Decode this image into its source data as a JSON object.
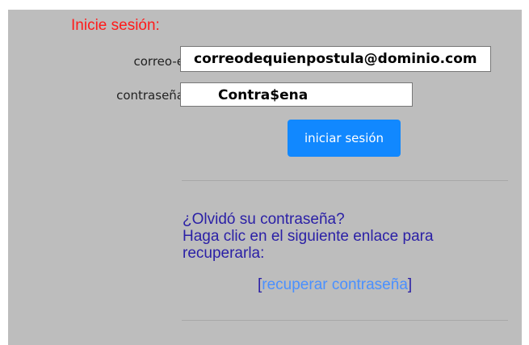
{
  "login": {
    "title": "Inicie sesión:",
    "email_label": "correo-e",
    "email_value": "correodequienpostula@dominio.com",
    "password_label": "contraseña",
    "password_value": "Contra$ena",
    "submit_label": "iniciar sesión"
  },
  "forgot": {
    "line1": "¿Olvidó su contraseña?",
    "line2": "Haga clic en el siguiente enlace para",
    "line3": "recuperarla:",
    "bracket_open": "[",
    "link_label": "recuperar contraseña",
    "bracket_close": "]"
  },
  "colors": {
    "panel_bg": "#bdbdbd",
    "title": "#ff1a1a",
    "button": "#1188ff",
    "text_blue": "#2a1fa6",
    "link_blue": "#4a90ff"
  }
}
